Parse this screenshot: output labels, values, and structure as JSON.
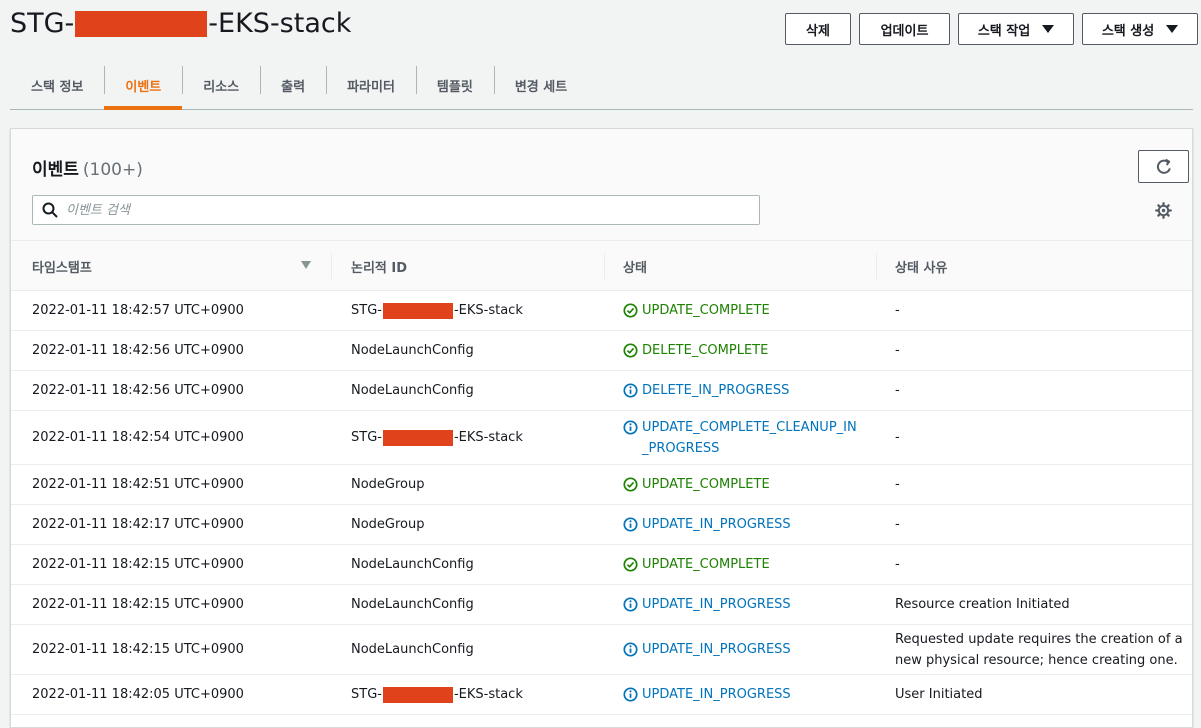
{
  "header": {
    "title_prefix": "STG-",
    "title_suffix": "-EKS-stack",
    "buttons": {
      "delete": "삭제",
      "update": "업데이트",
      "stack_actions": "스택 작업",
      "create_stack": "스택 생성"
    }
  },
  "tabs": [
    "스택 정보",
    "이벤트",
    "리소스",
    "출력",
    "파라미터",
    "템플릿",
    "변경 세트"
  ],
  "active_tab": "이벤트",
  "panel": {
    "title": "이벤트",
    "count": "(100+)",
    "search_placeholder": "이벤트 검색"
  },
  "columns": {
    "timestamp": "타임스탬프",
    "logical_id": "논리적 ID",
    "status": "상태",
    "status_reason": "상태 사유"
  },
  "colors": {
    "accent": "#ec7211",
    "success": "#1d8102",
    "info": "#0073bb",
    "redaction": "#e0421b"
  },
  "events": [
    {
      "timestamp": "2022-01-11 18:42:57 UTC+0900",
      "id_prefix": "STG-",
      "id_suffix": "-EKS-stack",
      "status": "UPDATE_COMPLETE",
      "kind": "ok",
      "reason": "-"
    },
    {
      "timestamp": "2022-01-11 18:42:56 UTC+0900",
      "id": "NodeLaunchConfig",
      "status": "DELETE_COMPLETE",
      "kind": "ok",
      "reason": "-"
    },
    {
      "timestamp": "2022-01-11 18:42:56 UTC+0900",
      "id": "NodeLaunchConfig",
      "status": "DELETE_IN_PROGRESS",
      "kind": "info",
      "reason": "-"
    },
    {
      "timestamp": "2022-01-11 18:42:54 UTC+0900",
      "id_prefix": "STG-",
      "id_suffix": "-EKS-stack",
      "status": "UPDATE_COMPLETE_CLEANUP_IN_PROGRESS",
      "kind": "info",
      "reason": "-"
    },
    {
      "timestamp": "2022-01-11 18:42:51 UTC+0900",
      "id": "NodeGroup",
      "status": "UPDATE_COMPLETE",
      "kind": "ok",
      "reason": "-"
    },
    {
      "timestamp": "2022-01-11 18:42:17 UTC+0900",
      "id": "NodeGroup",
      "status": "UPDATE_IN_PROGRESS",
      "kind": "info",
      "reason": "-"
    },
    {
      "timestamp": "2022-01-11 18:42:15 UTC+0900",
      "id": "NodeLaunchConfig",
      "status": "UPDATE_COMPLETE",
      "kind": "ok",
      "reason": "-"
    },
    {
      "timestamp": "2022-01-11 18:42:15 UTC+0900",
      "id": "NodeLaunchConfig",
      "status": "UPDATE_IN_PROGRESS",
      "kind": "info",
      "reason": "Resource creation Initiated"
    },
    {
      "timestamp": "2022-01-11 18:42:15 UTC+0900",
      "id": "NodeLaunchConfig",
      "status": "UPDATE_IN_PROGRESS",
      "kind": "info",
      "reason": "Requested update requires the creation of a new physical resource; hence creating one."
    },
    {
      "timestamp": "2022-01-11 18:42:05 UTC+0900",
      "id_prefix": "STG-",
      "id_suffix": "-EKS-stack",
      "status": "UPDATE_IN_PROGRESS",
      "kind": "info",
      "reason": "User Initiated"
    }
  ]
}
